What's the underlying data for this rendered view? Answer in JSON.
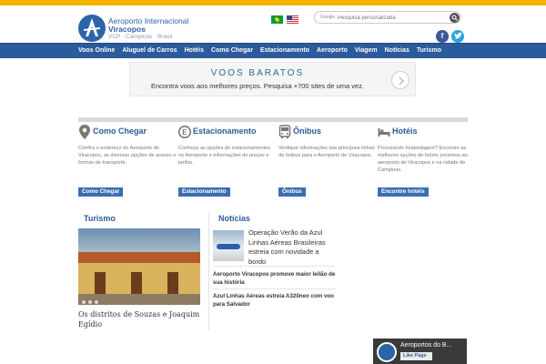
{
  "header": {
    "logo_line1": "Aeroporto Internacional",
    "logo_line2": "Viracopos",
    "logo_line3": "VCP · Campinas · Brasil",
    "search_brand": "Google",
    "search_placeholder": "Pesquisa personalizada"
  },
  "nav": {
    "items": [
      "Voos Online",
      "Aluguel de Carros",
      "Hotéis",
      "Como Chegar",
      "Estacionamento",
      "Aeroporto",
      "Viagem",
      "Notícias",
      "Turismo"
    ]
  },
  "ad": {
    "title": "VOOS BARATOS",
    "subtitle": "Encontra voos aos melhores preços. Pesquisa +700 sites de uma vez."
  },
  "cards": [
    {
      "title": "Como Chegar",
      "text": "Confira o endereço do Aeroporto de Viracopos, as diversas opções de acesso e formas de transporte.",
      "button": "Como Chegar"
    },
    {
      "title": "Estacionamento",
      "text": "Conheça as opções de estacionamentos no Aeroporto e informações de preços e tarifas.",
      "button": "Estacionamento"
    },
    {
      "title": "Ônibus",
      "text": "Verifique informações das principais linhas de ônibus para o Aeroporto de Viracopos.",
      "button": "Ônibus"
    },
    {
      "title": "Hotéis",
      "text": "Procurando hospedagem? Encontre as melhores opções de hotéis próximos ao aeroporto de Viracopos e na cidade de Campinas.",
      "button": "Encontre hotéis"
    }
  ],
  "turismo": {
    "title": "Turismo",
    "caption": "Os distritos de Souzas e Joaquim Egídio"
  },
  "noticias": {
    "title": "Notícias",
    "items": [
      "Operação Verão da Azul Linhas Aéreas Brasileiras estreia com novidade a bordo",
      "Aeroporto Viracopos promove maior leilão de sua história",
      "Azul Linhas Aéreas estreia A320neo com voo para Salvador"
    ]
  },
  "fb": {
    "name": "Aeroportos do B...",
    "like": "Like Page"
  },
  "colors": {
    "brand": "#2c5b9b",
    "accent": "#f3b300"
  }
}
